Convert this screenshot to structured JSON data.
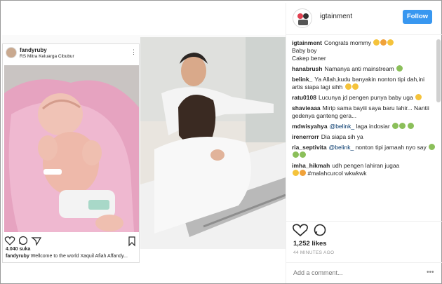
{
  "left_post": {
    "username": "fandyruby",
    "location": "RS Mitra Keluarga Cibubur",
    "likes": "4.040 suka",
    "caption_user": "fandyruby",
    "caption_text": "Wellcome to the world Xaquil Afiah Affandy..."
  },
  "right_panel": {
    "username": "igtainment",
    "follow_label": "Follow",
    "likes": "1,252 likes",
    "time": "44 MINUTES AGO",
    "comment_placeholder": "Add a comment..."
  },
  "comments": [
    {
      "user": "igtainment",
      "text": "Congrats mommy",
      "text2": "Baby boy",
      "text3": "Cakep bener"
    },
    {
      "user": "hanabrush",
      "text": "Namanya anti mainstream"
    },
    {
      "user": "belink_",
      "text": "Ya Allah,kudu banyakin nonton tipi dah,ini artis siapa lagi sihh"
    },
    {
      "user": "ratu0108",
      "text": "Lucunya jd pengen punya baby uga"
    },
    {
      "user": "shavieaaa",
      "text": "Mirip sama bayiii saya baru lahir... Nantii gedenya ganteng gera..."
    },
    {
      "user": "mdwisyahya",
      "mention": "@belink_",
      "text": "laga indosiar"
    },
    {
      "user": "irenerrorr",
      "text": "Dia siapa sih ya"
    },
    {
      "user": "ria_septivita",
      "mention": "@belink_",
      "text": "nonton tipi jamaah nyo say"
    },
    {
      "user": "imha_hikmah",
      "text": "udh pengen lahiran jugaa",
      "text2": "#malahcurcol wkwkwk"
    }
  ],
  "colors": {
    "follow_button": "#3897f0",
    "mention": "#003569"
  },
  "icons": [
    "heart-icon",
    "comment-icon",
    "share-icon",
    "bookmark-icon",
    "more-icon"
  ]
}
